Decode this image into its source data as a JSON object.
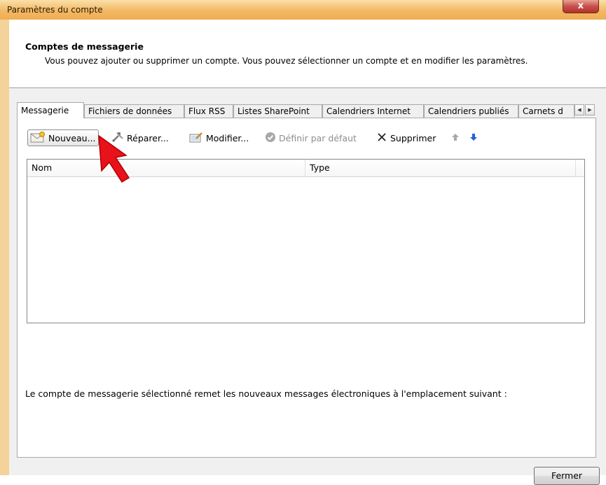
{
  "window": {
    "title": "Paramètres du compte",
    "close_glyph": "x"
  },
  "header": {
    "title": "Comptes de messagerie",
    "description": "Vous pouvez ajouter ou supprimer un compte. Vous pouvez sélectionner un compte et en modifier les paramètres."
  },
  "tabs": [
    {
      "label": "Messagerie",
      "active": true
    },
    {
      "label": "Fichiers de données",
      "active": false
    },
    {
      "label": "Flux RSS",
      "active": false
    },
    {
      "label": "Listes SharePoint",
      "active": false
    },
    {
      "label": "Calendriers Internet",
      "active": false
    },
    {
      "label": "Calendriers publiés",
      "active": false
    },
    {
      "label": "Carnets d",
      "active": false
    }
  ],
  "toolbar": {
    "new_label": "Nouveau...",
    "repair_label": "Réparer...",
    "modify_label": "Modifier...",
    "default_label": "Définir par défaut",
    "delete_label": "Supprimer"
  },
  "list": {
    "columns": [
      "Nom",
      "Type"
    ],
    "rows": []
  },
  "info_text": "Le compte de messagerie sélectionné remet les nouveaux messages électroniques à l'emplacement suivant :",
  "footer": {
    "close_label": "Fermer"
  },
  "colors": {
    "title_bar": "#f2b865",
    "close_button": "#c75050",
    "cursor_red": "#e8121a",
    "arrow_blue": "#2a5fcf"
  }
}
